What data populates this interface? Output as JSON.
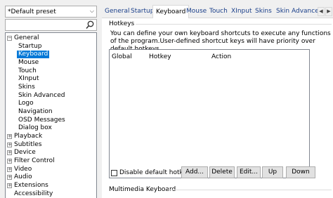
{
  "preset": {
    "value": "*Default preset"
  },
  "search": {
    "value": ""
  },
  "tree": {
    "general": "General",
    "general_children": [
      "Startup",
      "Keyboard",
      "Mouse",
      "Touch",
      "XInput",
      "Skins",
      "Skin Advanced",
      "Logo",
      "Navigation",
      "OSD Messages",
      "Dialog box"
    ],
    "others": [
      "Playback",
      "Subtitles",
      "Device",
      "Filter Control",
      "Video",
      "Audio",
      "Extensions",
      "Accessibility"
    ]
  },
  "tabs": [
    "General",
    "Startup",
    "Keyboard",
    "Mouse",
    "Touch",
    "XInput",
    "Skins",
    "Skin Advance"
  ],
  "hotkeys": {
    "group_title": "Hotkeys",
    "description": "You can define your own keyboard shortcuts to execute any functions of the program.User-defined shortcut keys will have priority over default hotkeys.",
    "columns": [
      "Global",
      "Hotkey",
      "Action"
    ],
    "disable_label": "Disable default hotkeys",
    "buttons": {
      "add": "Add...",
      "delete": "Delete",
      "edit": "Edit...",
      "up": "Up",
      "down": "Down"
    }
  },
  "multimedia": {
    "group_title": "Multimedia Keyboard"
  },
  "colors": {
    "selection": "#0078d7",
    "tab_text": "#1a3f8a"
  }
}
